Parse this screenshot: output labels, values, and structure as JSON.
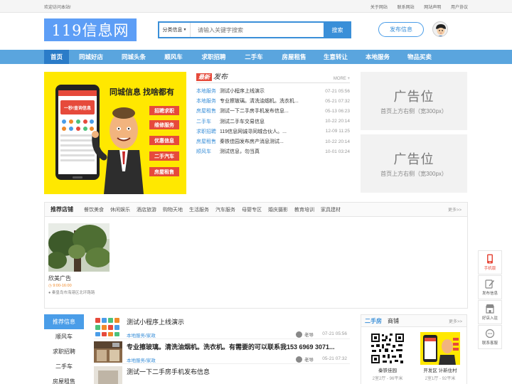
{
  "topbar": {
    "welcome": "欢迎访问本站!",
    "links": [
      "关于网站",
      "联系网站",
      "网站声明",
      "用户协议"
    ]
  },
  "header": {
    "logo_text": "119信息网",
    "search": {
      "category": "分类信息",
      "placeholder": "请输入关键字搜索",
      "button": "搜索"
    },
    "post_button": "发布信息"
  },
  "nav": [
    "首页",
    "同城好店",
    "同城头条",
    "顺风车",
    "求职招聘",
    "二手车",
    "房屋租售",
    "生意转让",
    "本地服务",
    "物品买卖"
  ],
  "promo": {
    "headline": "同城信息 找啥都有",
    "tags": [
      "招聘求职",
      "维修服务",
      "优惠信息",
      "二手汽车",
      "房屋租售"
    ],
    "phone_label": "一秒!查询信息"
  },
  "latest": {
    "badge": "最新",
    "title": "发布",
    "more": "MORE +",
    "items": [
      {
        "cat": "本地服务",
        "title": "测试小程序上线演示",
        "date": "07-21 05:56"
      },
      {
        "cat": "本地服务",
        "title": "专业擦玻璃。清洗油烟机。洗衣机...",
        "date": "05-21 07:32"
      },
      {
        "cat": "房屋租售",
        "title": "测试一下二手房手机发布信息...",
        "date": "05-13 06:23"
      },
      {
        "cat": "二手车",
        "title": "测试二手车交易信息",
        "date": "10-22 20:14"
      },
      {
        "cat": "求职招聘",
        "title": "119信息网诚寻同城合伙人。...",
        "date": "12-09 11:25"
      },
      {
        "cat": "房屋租售",
        "title": "秦铁佳园发布房产消息测试...",
        "date": "10-22 20:14"
      },
      {
        "cat": "顺风车",
        "title": "测试信息，勿当真",
        "date": "10-01 03:24"
      }
    ]
  },
  "ads": [
    {
      "title": "广告位",
      "desc": "首页上方右侧（宽300px）"
    },
    {
      "title": "广告位",
      "desc": "首页上方右侧（宽300px）"
    }
  ],
  "shops": {
    "title": "推荐店铺",
    "categories": [
      "餐饮美食",
      "休闲娱乐",
      "酒店旅游",
      "购物天地",
      "生活服务",
      "汽车服务",
      "母婴专区",
      "婚庆摄影",
      "教育培训",
      "家具建材"
    ],
    "more": "更多>>",
    "card": {
      "name": "欣美广告",
      "hours": "9:00-16:00",
      "address": "秦皇岛市海港区北环路路"
    }
  },
  "sidebar": [
    "推荐信息",
    "顺风车",
    "求职招聘",
    "二手车",
    "房屋租售"
  ],
  "list": [
    {
      "title": "测试小程序上线演示",
      "cat": "本地服务/家政",
      "author": "老导",
      "date": "07-21 05:56"
    },
    {
      "title": "专业擦玻璃。清洗油烟机。洗衣机。有需要的可以联系我153 6969 3071...",
      "cat": "本地服务/家政",
      "author": "老导",
      "date": "05-21 07:32"
    },
    {
      "title": "测试一下二手房手机发布信息",
      "cat": "",
      "author": "",
      "date": ""
    }
  ],
  "esf": {
    "tag": "二手房",
    "title": "商铺",
    "more": "更多>>",
    "items": [
      {
        "name": "秦铁佳园",
        "price": "2室2厅 - 96平米"
      },
      {
        "name": "开发区 计新住村",
        "price": "2室1厅 - 92平米"
      }
    ]
  },
  "float": [
    "手机版",
    "发布信息",
    "好店入驻",
    "联系客服"
  ],
  "colors": {
    "primary": "#3a8fd8",
    "nav": "#5aa5de",
    "accent": "#e64a3b",
    "promo": "#ffe800"
  }
}
